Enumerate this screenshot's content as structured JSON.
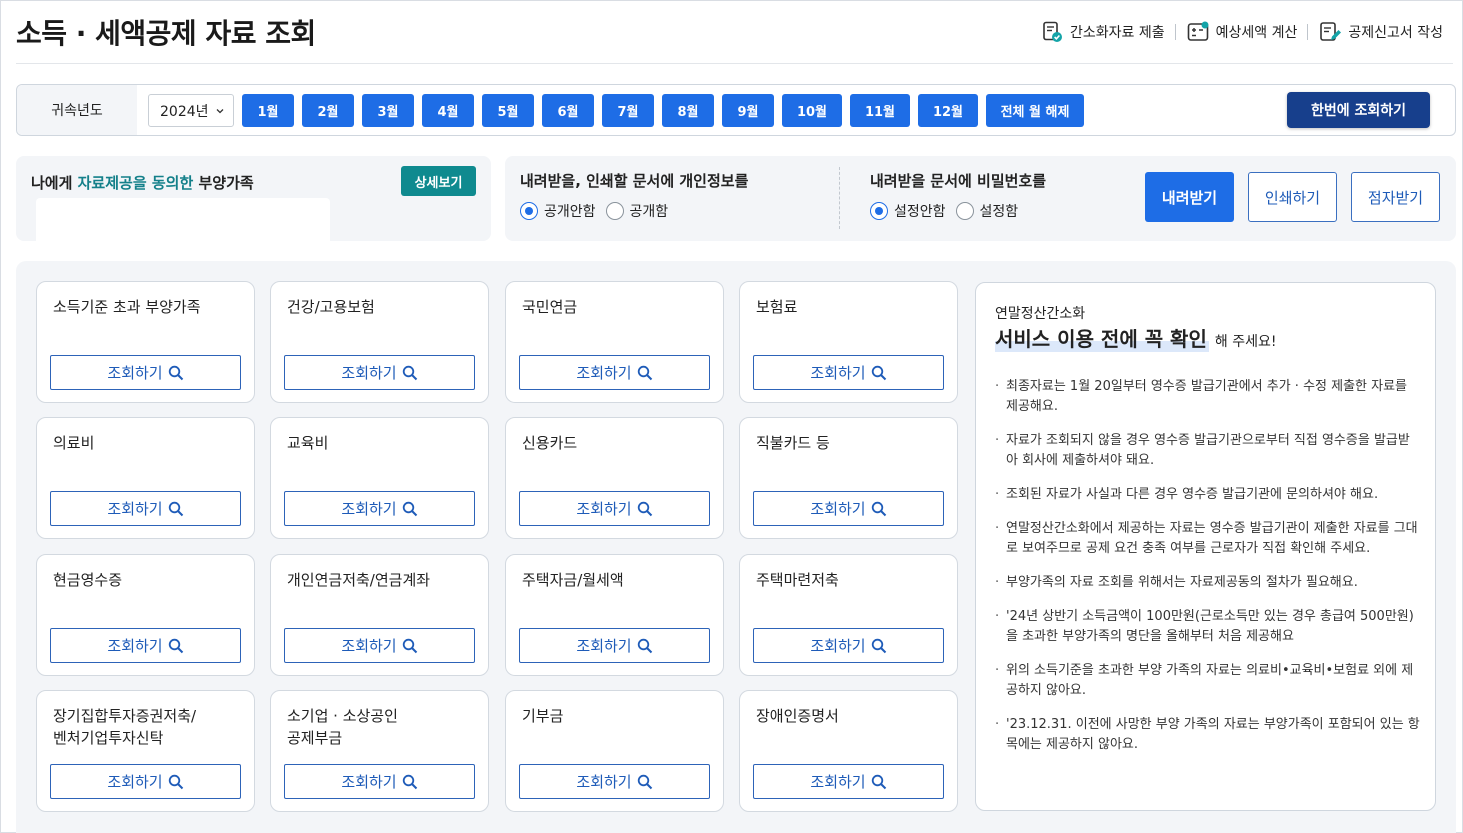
{
  "page": {
    "title": "소득 · 세액공제 자료 조회"
  },
  "header_actions": [
    {
      "label": "간소화자료 제출",
      "icon": "document-check-icon"
    },
    {
      "label": "예상세액 계산",
      "icon": "calculator-icon"
    },
    {
      "label": "공제신고서 작성",
      "icon": "document-edit-icon"
    }
  ],
  "period": {
    "label": "귀속년도",
    "year_selected": "2024년",
    "months": [
      "1월",
      "2월",
      "3월",
      "4월",
      "5월",
      "6월",
      "7월",
      "8월",
      "9월",
      "10월",
      "11월",
      "12월"
    ],
    "clear_all": "전체 월 해제",
    "query_all": "한번에 조회하기"
  },
  "dependents": {
    "title_prefix": "나에게 ",
    "title_highlight": "자료제공을 동의한",
    "title_suffix": " 부양가족",
    "detail_button": "상세보기"
  },
  "options": {
    "personal_info": {
      "title": "내려받을, 인쇄할 문서에 개인정보를",
      "choices": [
        "공개안함",
        "공개함"
      ],
      "selected": 0
    },
    "password": {
      "title": "내려받을 문서에 비밀번호를",
      "choices": [
        "설정안함",
        "설정함"
      ],
      "selected": 0
    },
    "download": "내려받기",
    "print": "인쇄하기",
    "braille": "점자받기"
  },
  "categories": [
    "소득기준 초과 부양가족",
    "건강/고용보험",
    "국민연금",
    "보험료",
    "의료비",
    "교육비",
    "신용카드",
    "직불카드 등",
    "현금영수증",
    "개인연금저축/연금계좌",
    "주택자금/월세액",
    "주택마련저축",
    "장기집합투자증권저축/\n벤처기업투자신탁",
    "소기업 · 소상공인\n공제부금",
    "기부금",
    "장애인증명서"
  ],
  "query_button": "조회하기",
  "info": {
    "subtitle": "연말정산간소화",
    "heading_strong": "서비스 이용 전에 꼭 확인",
    "heading_rest": "해 주세요!",
    "notes": [
      "최종자료는 1월 20일부터 영수증 발급기관에서 추가 · 수정 제출한 자료를 제공해요.",
      "자료가 조회되지 않을 경우 영수증 발급기관으로부터 직접 영수증을 발급받아 회사에 제출하셔야 돼요.",
      "조회된 자료가 사실과 다른 경우 영수증 발급기관에 문의하셔야 해요.",
      "연말정산간소화에서 제공하는 자료는 영수증 발급기관이 제출한 자료를 그대로 보여주므로 공제 요건 충족 여부를 근로자가 직접 확인해 주세요.",
      "부양가족의 자료 조회를 위해서는 자료제공동의 절차가 필요해요.",
      "'24년 상반기 소득금액이 100만원(근로소득만 있는 경우 총급여 500만원)을 초과한 부양가족의 명단을 올해부터 처음 제공해요",
      "위의 소득기준을 초과한 부양 가족의 자료는 의료비•교육비•보험료 외에 제공하지 않아요.",
      "'23.12.31. 이전에 사망한 부양 가족의 자료는 부양가족이 포함되어 있는 항목에는 제공하지 않아요."
    ]
  },
  "colors": {
    "primary": "#1e6de6",
    "navy": "#173f8c",
    "teal": "#0f8a8f",
    "panel_bg": "#f3f5f8"
  }
}
